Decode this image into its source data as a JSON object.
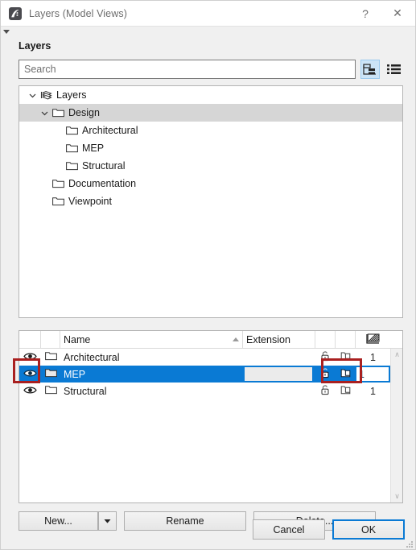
{
  "window": {
    "title": "Layers (Model Views)",
    "app_icon": "archicad-logo-icon",
    "help_label": "?",
    "close_label": "✕"
  },
  "panel": {
    "section_label": "Layers"
  },
  "search": {
    "placeholder": "Search",
    "value": "",
    "tree_view_icon": "tree-view-icon",
    "list_view_icon": "list-view-icon",
    "active_view": "tree"
  },
  "tree": {
    "items": [
      {
        "label": "Layers",
        "depth": 0,
        "icon": "layers-stack-icon",
        "expanded": true,
        "chevron": "⌄",
        "selected": false
      },
      {
        "label": "Design",
        "depth": 1,
        "icon": "folder-icon",
        "expanded": true,
        "chevron": "⌄",
        "selected": true
      },
      {
        "label": "Architectural",
        "depth": 2,
        "icon": "folder-icon",
        "expanded": null,
        "chevron": "",
        "selected": false
      },
      {
        "label": "MEP",
        "depth": 2,
        "icon": "folder-icon",
        "expanded": null,
        "chevron": "",
        "selected": false
      },
      {
        "label": "Structural",
        "depth": 2,
        "icon": "folder-icon",
        "expanded": null,
        "chevron": "",
        "selected": false
      },
      {
        "label": "Documentation",
        "depth": 1,
        "icon": "folder-icon",
        "expanded": null,
        "chevron": "",
        "selected": false
      },
      {
        "label": "Viewpoint",
        "depth": 1,
        "icon": "folder-icon",
        "expanded": null,
        "chevron": "",
        "selected": false
      }
    ]
  },
  "table": {
    "columns": {
      "eye": "",
      "folder": "",
      "name": "Name",
      "extension": "Extension",
      "lock": "",
      "copy": "",
      "pen": ""
    },
    "name_sort": "ascending",
    "pen_header_icon": "hatch-pattern-icon",
    "rows": [
      {
        "visible_icon": "eye-icon",
        "folder_icon": "folder-icon",
        "name": "Architectural",
        "extension": "",
        "lock_icon": "unlock-icon",
        "copy_icon": "copy-icon",
        "pen": "1",
        "selected": false
      },
      {
        "visible_icon": "eye-icon",
        "folder_icon": "folder-icon",
        "name": "MEP",
        "extension": "",
        "lock_icon": "unlock-icon",
        "copy_icon": "copy-icon",
        "pen": "1",
        "selected": true
      },
      {
        "visible_icon": "eye-icon",
        "folder_icon": "folder-icon",
        "name": "Structural",
        "extension": "",
        "lock_icon": "unlock-icon",
        "copy_icon": "copy-icon",
        "pen": "1",
        "selected": false
      }
    ],
    "scrollbar": {
      "up": "∧",
      "down": "∨"
    }
  },
  "annotations": [
    {
      "name": "eye-toggle-highlight",
      "color": "#a92020"
    },
    {
      "name": "lock-copy-highlight",
      "color": "#a92020"
    }
  ],
  "buttons": {
    "new": "New...",
    "new_dropdown_icon": "chevron-down-icon",
    "rename": "Rename",
    "delete": "Delete...",
    "cancel": "Cancel",
    "ok": "OK"
  },
  "colors": {
    "selection_blue": "#0a7ad4",
    "tree_selection_gray": "#d6d6d6",
    "annotation_red": "#a92020",
    "dialog_bg": "#f0f0f0",
    "focus_blue": "#0a7ad4"
  }
}
